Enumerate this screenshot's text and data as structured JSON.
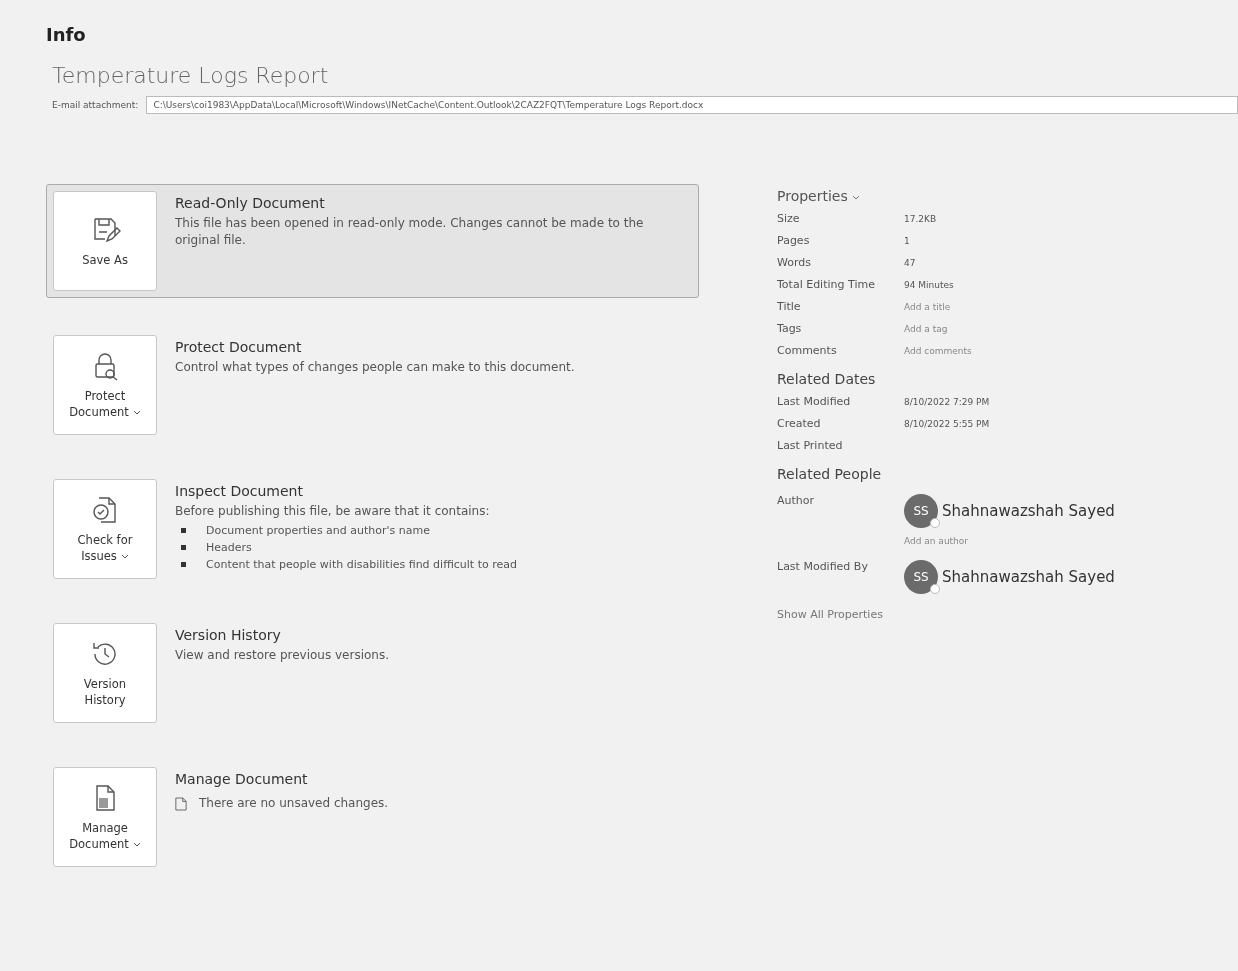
{
  "page_title": "Info",
  "document_title": "Temperature Logs Report",
  "attachment": {
    "label": "E-mail attachment:",
    "value": "C:\\Users\\coi1983\\AppData\\Local\\Microsoft\\Windows\\INetCache\\Content.Outlook\\2CAZ2FQT\\Temperature Logs Report.docx"
  },
  "sections": [
    {
      "kind": "save",
      "button": "Save As",
      "dropdown": false,
      "selected": true,
      "title": "Read-Only Document",
      "description": "This file has been opened in read-only mode. Changes cannot be made to the original file."
    },
    {
      "kind": "lock",
      "button": "Protect Document",
      "dropdown": true,
      "selected": false,
      "title": "Protect Document",
      "description": "Control what types of changes people can make to this document."
    },
    {
      "kind": "inspect",
      "button": "Check for Issues",
      "dropdown": true,
      "selected": false,
      "title": "Inspect Document",
      "description": "Before publishing this file, be aware that it contains:",
      "bullets": [
        "Document properties and author's name",
        "Headers",
        "Content that people with disabilities find difficult to read"
      ]
    },
    {
      "kind": "history",
      "button": "Version History",
      "dropdown": false,
      "selected": false,
      "title": "Version History",
      "description": "View and restore previous versions."
    },
    {
      "kind": "manage",
      "button": "Manage Document",
      "dropdown": true,
      "selected": false,
      "title": "Manage Document",
      "note": "There are no unsaved changes."
    }
  ],
  "properties": {
    "title": "Properties",
    "rows": [
      {
        "label": "Size",
        "value": "17.2KB"
      },
      {
        "label": "Pages",
        "value": "1"
      },
      {
        "label": "Words",
        "value": "47"
      },
      {
        "label": "Total Editing Time",
        "value": "94 Minutes"
      },
      {
        "label": "Title",
        "placeholder": "Add a title"
      },
      {
        "label": "Tags",
        "placeholder": "Add a tag"
      },
      {
        "label": "Comments",
        "placeholder": "Add comments"
      }
    ]
  },
  "related_dates": {
    "title": "Related Dates",
    "rows": [
      {
        "label": "Last Modified",
        "value": "8/10/2022 7:29 PM"
      },
      {
        "label": "Created",
        "value": "8/10/2022 5:55 PM"
      },
      {
        "label": "Last Printed"
      }
    ]
  },
  "related_people": {
    "title": "Related People",
    "rows": [
      {
        "label": "Author",
        "initials": "SS",
        "name": "Shahnawazshah Sayed",
        "action": "Add an author"
      },
      {
        "label": "Last Modified By",
        "initials": "SS",
        "name": "Shahnawazshah Sayed"
      }
    ]
  },
  "show_all": "Show All Properties"
}
